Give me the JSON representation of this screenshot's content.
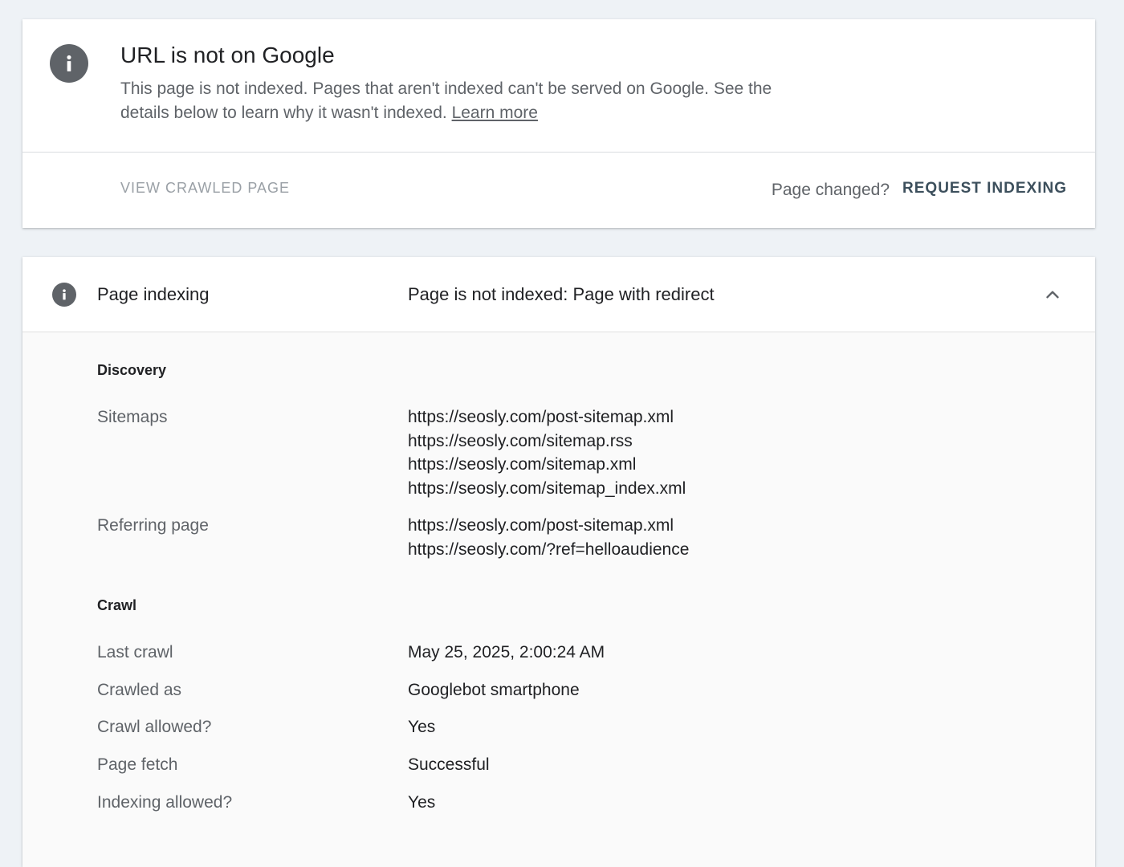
{
  "status_card": {
    "title": "URL is not on Google",
    "description": "This page is not indexed. Pages that aren't indexed can't be served on Google. See the details below to learn why it wasn't indexed.",
    "learn_more": "Learn more",
    "view_crawled_label": "VIEW CRAWLED PAGE",
    "page_changed_text": "Page changed?",
    "request_indexing_label": "REQUEST INDEXING"
  },
  "indexing_card": {
    "header_label": "Page indexing",
    "header_value": "Page is not indexed: Page with redirect",
    "discovery_title": "Discovery",
    "sitemaps_label": "Sitemaps",
    "sitemaps": [
      "https://seosly.com/post-sitemap.xml",
      "https://seosly.com/sitemap.rss",
      "https://seosly.com/sitemap.xml",
      "https://seosly.com/sitemap_index.xml"
    ],
    "referring_label": "Referring page",
    "referring": [
      "https://seosly.com/post-sitemap.xml",
      "https://seosly.com/?ref=helloaudience"
    ],
    "crawl_title": "Crawl",
    "last_crawl_label": "Last crawl",
    "last_crawl_value": "May 25, 2025, 2:00:24 AM",
    "crawled_as_label": "Crawled as",
    "crawled_as_value": "Googlebot smartphone",
    "crawl_allowed_label": "Crawl allowed?",
    "crawl_allowed_value": "Yes",
    "page_fetch_label": "Page fetch",
    "page_fetch_value": "Successful",
    "indexing_allowed_label": "Indexing allowed?",
    "indexing_allowed_value": "Yes"
  },
  "icons": {
    "status": "info-icon",
    "section": "info-icon",
    "collapse": "chevron-up-icon"
  },
  "colors": {
    "background": "#eef2f6",
    "icon_gray": "#5f6368",
    "request_button": "#3c4f5c",
    "disabled_button": "#9aa0a6"
  }
}
